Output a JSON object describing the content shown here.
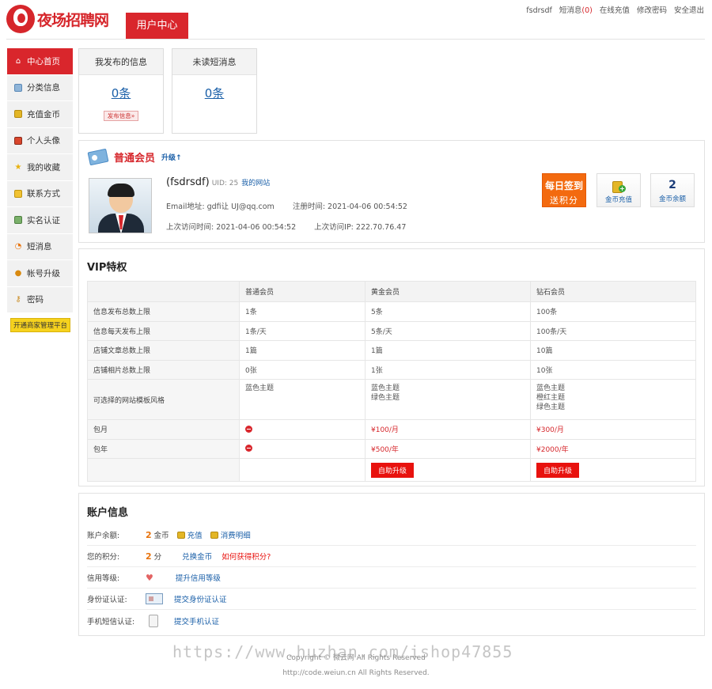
{
  "header": {
    "logo_text": "夜场招聘网",
    "user_center_tab": "用户中心",
    "top_links": {
      "username": "fsdrsdf",
      "messages": "短消息",
      "messages_count": "(0)",
      "recharge": "在线充值",
      "change_password": "修改密码",
      "logout": "安全退出"
    }
  },
  "sidebar": {
    "items": [
      {
        "label": "中心首页",
        "icon": "home-icon"
      },
      {
        "label": "分类信息",
        "icon": "edit-icon"
      },
      {
        "label": "充值金币",
        "icon": "coins-icon"
      },
      {
        "label": "个人头像",
        "icon": "picture-icon"
      },
      {
        "label": "我的收藏",
        "icon": "star-icon"
      },
      {
        "label": "联系方式",
        "icon": "contact-icon"
      },
      {
        "label": "实名认证",
        "icon": "id-card-icon"
      },
      {
        "label": "短消息",
        "icon": "chat-icon"
      },
      {
        "label": "帐号升级",
        "icon": "user-icon"
      },
      {
        "label": "密码",
        "icon": "key-icon"
      }
    ],
    "merchant_button": "开通商家管理平台"
  },
  "stats": {
    "published": {
      "title": "我发布的信息",
      "count": "0条",
      "button": "发布信息»"
    },
    "unread": {
      "title": "未读短消息",
      "count": "0条"
    }
  },
  "member": {
    "level": "普通会员",
    "upgrade": "升级↑",
    "name": "(fsdrsdf)",
    "uid": "UID: 25",
    "my_site": "我的网站",
    "email": "Email地址: gdfi让 UJ@qq.com",
    "register_time": "注册时间: 2021-04-06 00:54:52",
    "last_visit_time": "上次访问时间: 2021-04-06 00:54:52",
    "last_visit_ip": "上次访问IP: 222.70.76.47",
    "sign_in_line1": "每日签到",
    "sign_in_line2": "送积分",
    "coin_recharge": "金币充值",
    "coin_balance_value": "2",
    "coin_balance_label": "金币余额"
  },
  "vip": {
    "title": "VIP特权",
    "headers": [
      "",
      "普通会员",
      "黄金会员",
      "钻石会员"
    ],
    "rows": [
      {
        "label": "信息发布总数上限",
        "values": [
          "1条",
          "5条",
          "100条"
        ]
      },
      {
        "label": "信息每天发布上限",
        "values": [
          "1条/天",
          "5条/天",
          "100条/天"
        ]
      },
      {
        "label": "店铺文章总数上限",
        "values": [
          "1篇",
          "1篇",
          "10篇"
        ]
      },
      {
        "label": "店铺相片总数上限",
        "values": [
          "0张",
          "1张",
          "10张"
        ]
      }
    ],
    "theme_row": {
      "label": "可选择的网站模板风格",
      "normal": "蓝色主题",
      "gold": [
        "蓝色主题",
        "绿色主题"
      ],
      "diamond": [
        "蓝色主题",
        "橙红主题",
        "绿色主题"
      ]
    },
    "monthly": {
      "label": "包月",
      "gold": "¥100/月",
      "diamond": "¥300/月"
    },
    "yearly": {
      "label": "包年",
      "gold": "¥500/年",
      "diamond": "¥2000/年"
    },
    "upgrade_button": "自助升级"
  },
  "account": {
    "title": "账户信息",
    "balance_label": "账户余额:",
    "balance_value": "2",
    "balance_unit": "金币",
    "recharge": "充值",
    "consumption": "消费明细",
    "points_label": "您的积分:",
    "points_value": "2",
    "points_unit": "分",
    "exchange": "兑换金币",
    "how_points": "如何获得积分?",
    "credit_label": "信用等级:",
    "improve_credit": "提升信用等级",
    "id_label": "身份证认证:",
    "submit_id": "提交身份证认证",
    "sms_label": "手机短信认证:",
    "submit_sms": "提交手机认证"
  },
  "footer": {
    "copyright": "Copyright © 微云网 All Rights Reserved",
    "url_line": "http://code.weiun.cn All Rights Reserved.",
    "watermark": "https://www.huzhan.com/ishop47855"
  }
}
